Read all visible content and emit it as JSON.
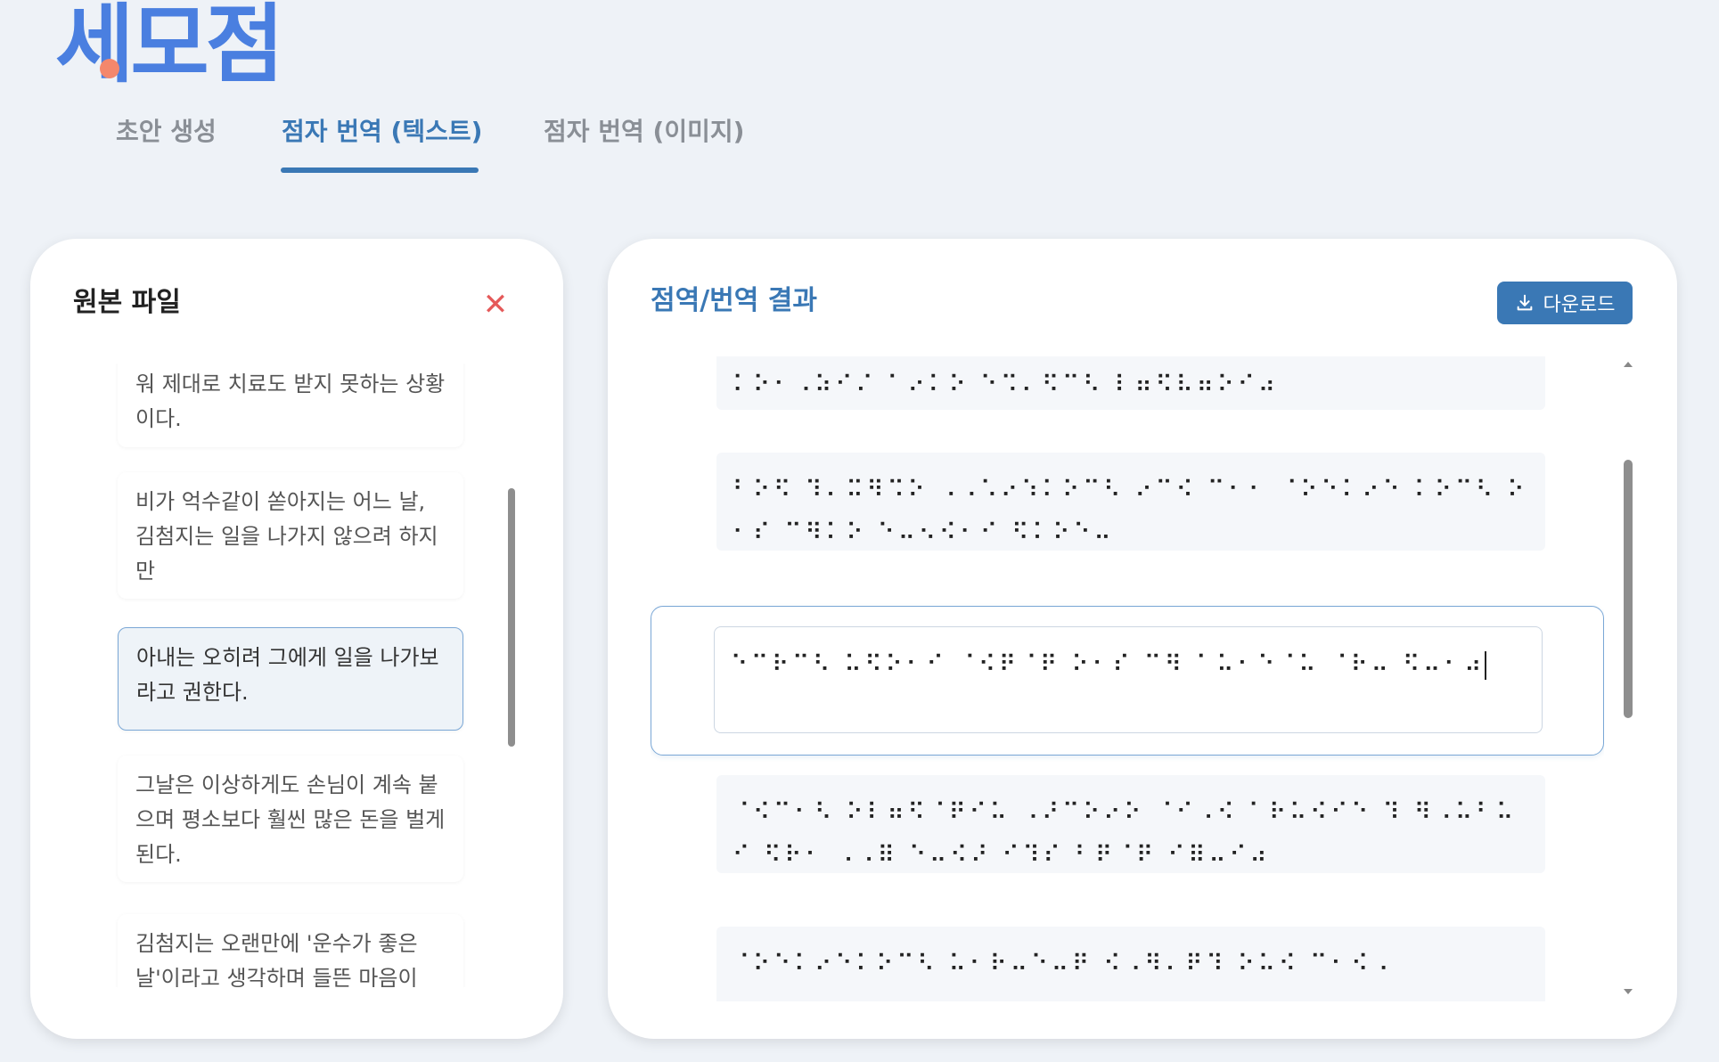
{
  "app": {
    "logo_text": "세모점"
  },
  "tabs": [
    {
      "label": "초안 생성",
      "active": false
    },
    {
      "label": "점자 번역 (텍스트)",
      "active": true
    },
    {
      "label": "점자 번역 (이미지)",
      "active": false
    }
  ],
  "left_panel": {
    "title": "원본 파일",
    "close_icon": "close-icon",
    "sentences": [
      "워 제대로 치료도 받지 못하는 상황이다.",
      "비가 억수같이 쏟아지는 어느 날, 김첨지는 일을 나가지 않으려 하지만",
      "아내는 오히려 그에게 일을 나가보라고 권한다.",
      "그날은 이상하게도 손님이 계속 붙으며 평소보다 훨씬 많은 돈을 벌게 된다.",
      "김첨지는 오랜만에 '운수가 좋은 날'이라고 생각하며 들뜬 마음이"
    ],
    "selected_index": 2
  },
  "right_panel": {
    "title": "점역/번역 결과",
    "download_label": "다운로드",
    "download_icon": "download-icon",
    "braille": [
      "⠅⠕⠂⠠⠵⠊⠌ ⠁⠔⠅⠕ ⠑⠩⠄⠫⠉⠣ ⠇⠶⠫⠧⠶⠕⠊⠴",
      "⠃⠕⠫ ⠹⠄⠭⠻⠩⠕ ⠠⠠⠡⠔⠱⠅⠕⠉⠣ ⠔⠉⠪ ⠉⠂⠂ ⠈⠕⠑⠅⠔⠑ ⠅⠕⠉⠣ ⠕⠂⠎ ⠉⠻⠅⠕ ⠑⠤⠢⠪⠂⠊ ⠫⠅⠕⠑⠤",
      "⠑⠉⠗⠉⠣ ⠥⠫⠕⠂⠊ ⠈⠪⠟⠈⠟ ⠕⠂⠎ ⠉⠻ ⠁⠥⠂⠑⠈⠥ ⠈⠗⠤ ⠫⠤⠂⠴",
      "⠈⠪⠉⠂⠣ ⠕⠇⠶⠫⠈⠟⠊⠥ ⠠⠜⠉⠕⠔⠕ ⠈⠊⠠⠪ ⠁⠗⠥⠪⠊⠑ ⠹ ⠻⠠⠥⠃⠥⠊ ⠫⠗⠂ ⠠⠠⠿ ⠑⠤⠪⠜ ⠊⠹⠎ ⠃⠟⠈⠟ ⠊⠿⠤⠊⠴",
      "⠈⠕⠑⠅⠔⠑⠅⠕⠉⠣ ⠥⠂⠗⠤⠑⠤⠟ ⠪⠠⠻⠄⠟⠹ ⠕⠥⠪ ⠉⠂⠪⠠"
    ],
    "selected_index": 2
  }
}
